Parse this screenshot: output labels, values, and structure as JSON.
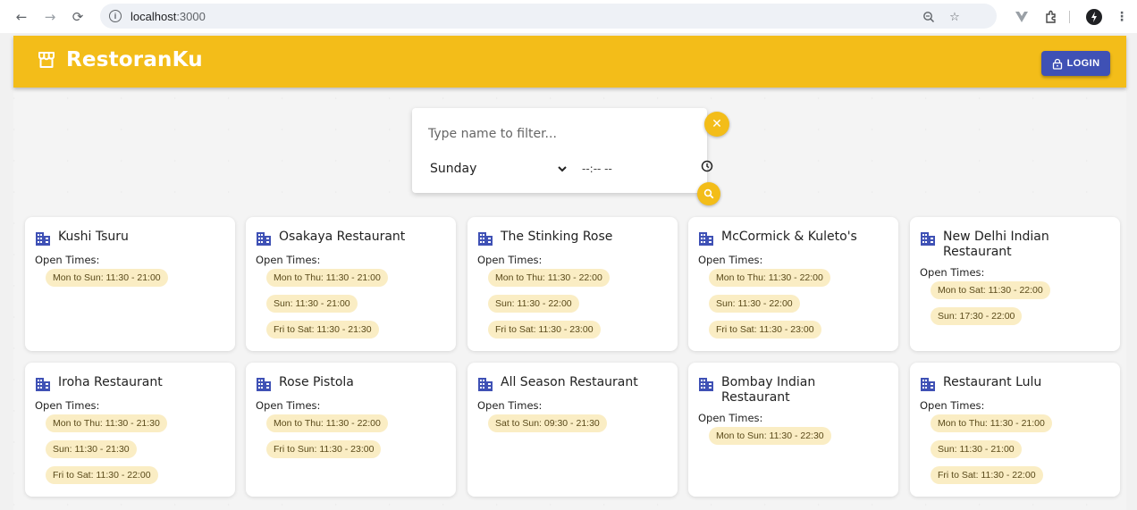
{
  "browser": {
    "url_host": "localhost",
    "url_port": ":3000"
  },
  "app": {
    "brand_name": "RestoranKu",
    "login_label": "LOGIN",
    "accent_color": "#f3bd19",
    "login_color": "#3f51b5"
  },
  "filter": {
    "name_placeholder": "Type name to filter...",
    "day_selected": "Sunday",
    "time_placeholder": "--:-- --",
    "clear_icon": "close-icon",
    "search_icon": "search-icon"
  },
  "open_times_label": "Open Times:",
  "restaurants": [
    {
      "name": "Kushi Tsuru",
      "times": [
        "Mon to Sun: 11:30 - 21:00"
      ]
    },
    {
      "name": "Osakaya Restaurant",
      "times": [
        "Mon to Thu: 11:30 - 21:00",
        "Sun: 11:30 - 21:00",
        "Fri to Sat: 11:30 - 21:30"
      ]
    },
    {
      "name": "The Stinking Rose",
      "times": [
        "Mon to Thu: 11:30 - 22:00",
        "Sun: 11:30 - 22:00",
        "Fri to Sat: 11:30 - 23:00"
      ]
    },
    {
      "name": "McCormick & Kuleto's",
      "times": [
        "Mon to Thu: 11:30 - 22:00",
        "Sun: 11:30 - 22:00",
        "Fri to Sat: 11:30 - 23:00"
      ]
    },
    {
      "name": "New Delhi Indian Restaurant",
      "times": [
        "Mon to Sat: 11:30 - 22:00",
        "Sun: 17:30 - 22:00"
      ]
    },
    {
      "name": "Iroha Restaurant",
      "times": [
        "Mon to Thu: 11:30 - 21:30",
        "Sun: 11:30 - 21:30",
        "Fri to Sat: 11:30 - 22:00"
      ]
    },
    {
      "name": "Rose Pistola",
      "times": [
        "Mon to Thu: 11:30 - 22:00",
        "Fri to Sun: 11:30 - 23:00"
      ]
    },
    {
      "name": "All Season Restaurant",
      "times": [
        "Sat to Sun: 09:30 - 21:30"
      ]
    },
    {
      "name": "Bombay Indian Restaurant",
      "times": [
        "Mon to Sun: 11:30 - 22:30"
      ]
    },
    {
      "name": "Restaurant Lulu",
      "times": [
        "Mon to Thu: 11:30 - 21:00",
        "Sun: 11:30 - 21:00",
        "Fri to Sat: 11:30 - 22:00"
      ]
    }
  ]
}
